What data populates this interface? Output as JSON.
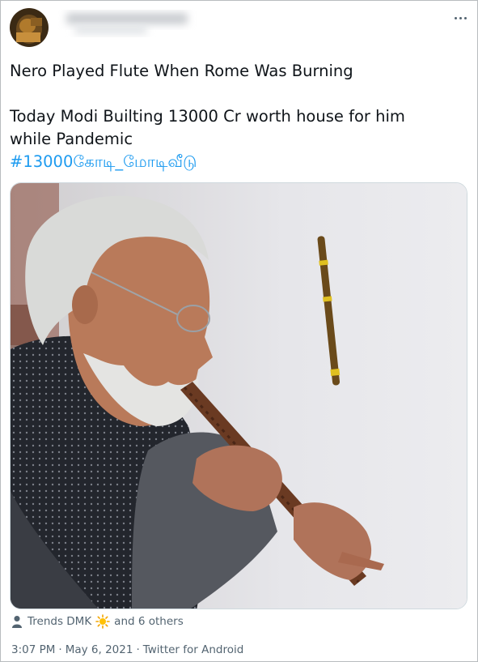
{
  "author": {
    "avatar_icon": "profile-photo-icon",
    "name_obscured": true
  },
  "tweet": {
    "line1": "Nero Played Flute When Rome Was Burning",
    "line2": "Today Modi Builting 13000 Cr worth house for him",
    "line3": "while Pandemic",
    "hashtag": "#13000கோடி_மோடிவீடு"
  },
  "media": {
    "description_icon": "photo-man-playing-flute-icon"
  },
  "trends": {
    "prefix": "Trends DMK",
    "emoji_icon": "sun-icon",
    "suffix": "and 6 others"
  },
  "meta": {
    "time": "3:07 PM",
    "date": "May 6, 2021",
    "source": "Twitter for Android",
    "separator": "·"
  },
  "colors": {
    "link": "#1d9bf0",
    "secondary_text": "#536471",
    "text": "#0f1419",
    "border": "#cfd9de"
  }
}
